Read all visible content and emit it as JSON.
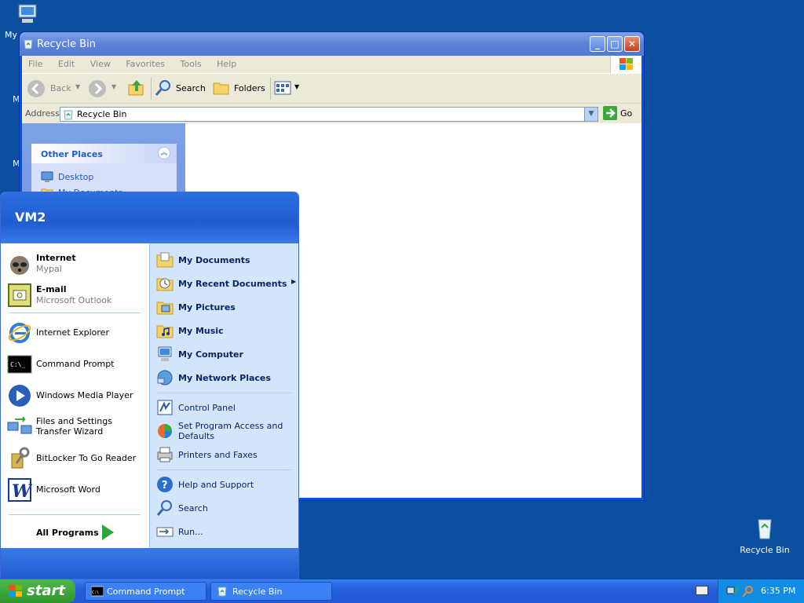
{
  "desktop": {
    "partial_icons": [
      "My",
      "M",
      "M"
    ],
    "recycle_bin_label": "Recycle Bin"
  },
  "window": {
    "title": "Recycle Bin",
    "menu": [
      "File",
      "Edit",
      "View",
      "Favorites",
      "Tools",
      "Help"
    ],
    "toolbar": {
      "back": "Back",
      "search": "Search",
      "folders": "Folders"
    },
    "address_label": "Address",
    "address_value": "Recycle Bin",
    "go": "Go",
    "side_panel": {
      "title": "Other Places",
      "items": [
        "Desktop",
        "My Documents"
      ]
    }
  },
  "start_menu": {
    "user": "VM2",
    "pinned": [
      {
        "title": "Internet",
        "sub": "Mypal"
      },
      {
        "title": "E-mail",
        "sub": "Microsoft Outlook"
      }
    ],
    "recent": [
      "Internet Explorer",
      "Command Prompt",
      "Windows Media Player",
      "Files and Settings Transfer Wizard",
      "BitLocker To Go Reader",
      "Microsoft Word"
    ],
    "all_programs": "All Programs",
    "right_top": [
      "My Documents",
      "My Recent Documents",
      "My Pictures",
      "My Music",
      "My Computer",
      "My Network Places"
    ],
    "right_mid": [
      "Control Panel",
      "Set Program Access and Defaults",
      "Printers and Faxes"
    ],
    "right_bottom": [
      "Help and Support",
      "Search",
      "Run..."
    ]
  },
  "taskbar": {
    "start": "start",
    "tasks": [
      "Command Prompt",
      "Recycle Bin"
    ],
    "clock": "6:35 PM"
  }
}
